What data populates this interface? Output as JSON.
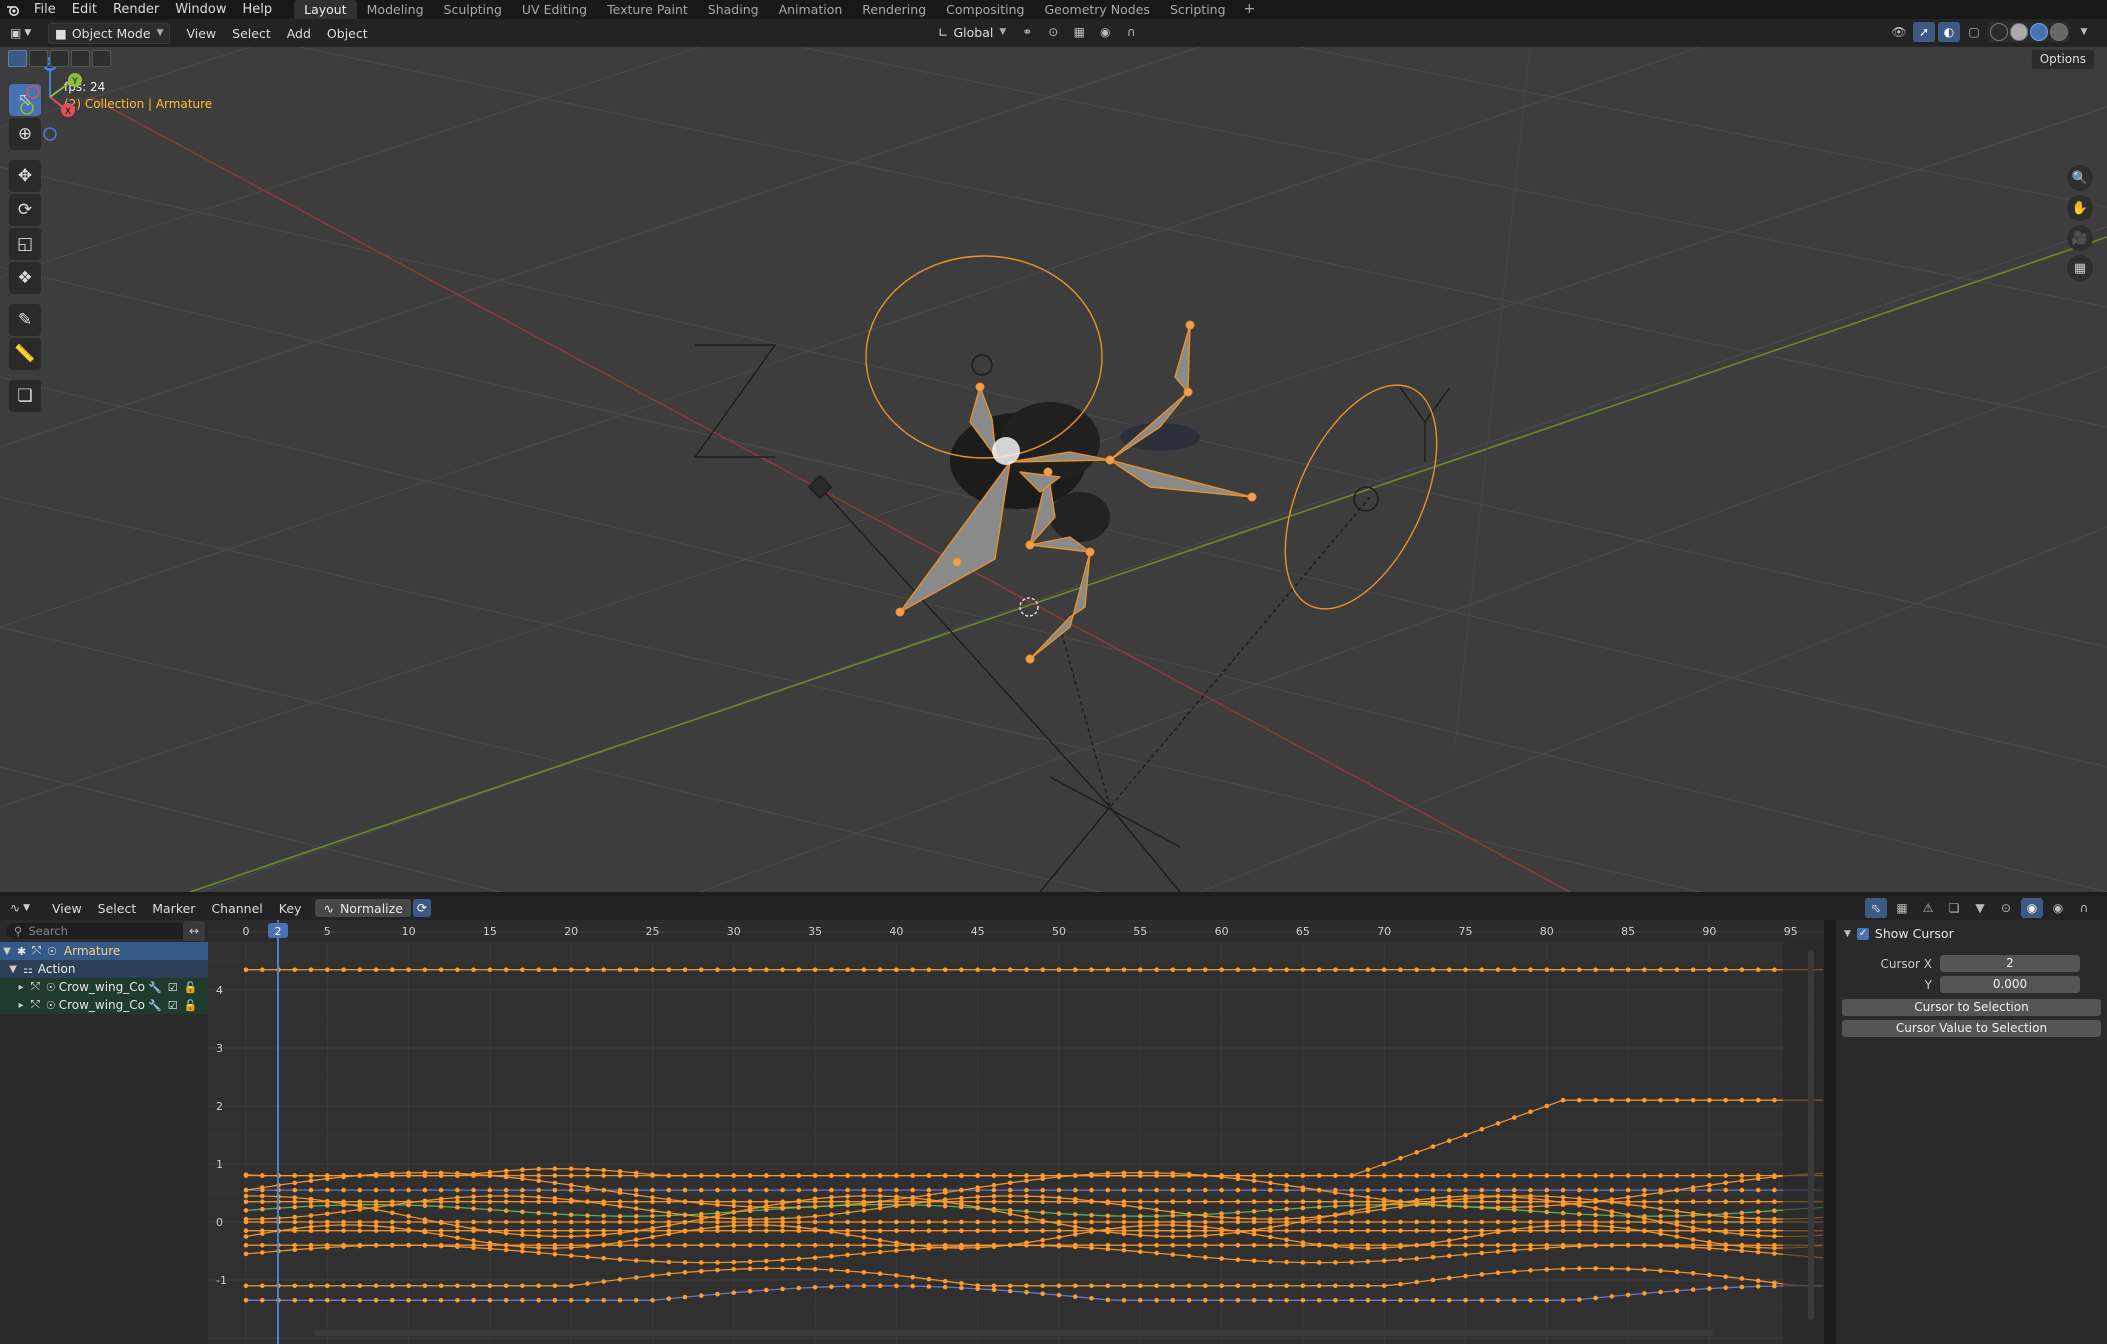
{
  "topbar": {
    "menus": [
      "File",
      "Edit",
      "Render",
      "Window",
      "Help"
    ],
    "workspaces": [
      "Layout",
      "Modeling",
      "Sculpting",
      "UV Editing",
      "Texture Paint",
      "Shading",
      "Animation",
      "Rendering",
      "Compositing",
      "Geometry Nodes",
      "Scripting"
    ],
    "active_workspace": "Layout",
    "add_tab": "+"
  },
  "viewport_header": {
    "mode": "Object Mode",
    "menus": [
      "View",
      "Select",
      "Add",
      "Object"
    ],
    "transform_orientation": "Global",
    "options": "Options"
  },
  "viewport": {
    "fps": "fps: 24",
    "collection": "(2) Collection | Armature",
    "axis_labels": {
      "x": "X",
      "y": "Y",
      "z": "Z"
    },
    "background_color": "#3d3d3d"
  },
  "graph_header": {
    "menus": [
      "View",
      "Select",
      "Marker",
      "Channel",
      "Key"
    ],
    "normalize": "Normalize"
  },
  "channels": {
    "search_placeholder": "Search",
    "rows": [
      {
        "label": "Armature",
        "kind": "object"
      },
      {
        "label": "Action",
        "kind": "action"
      },
      {
        "label": "Crow_wing_Co",
        "kind": "fcurve"
      },
      {
        "label": "Crow_wing_Co",
        "kind": "fcurve"
      }
    ]
  },
  "graph": {
    "frame_ticks": [
      "0",
      "5",
      "10",
      "15",
      "20",
      "25",
      "30",
      "35",
      "40",
      "45",
      "50",
      "55",
      "60",
      "65",
      "70",
      "75",
      "80",
      "85",
      "90",
      "95"
    ],
    "current_frame": "2",
    "value_ticks": [
      "4",
      "3",
      "2",
      "1",
      "0",
      "-1"
    ],
    "accent": "#ff9a2a"
  },
  "sidebar": {
    "show_cursor": "Show Cursor",
    "cursor_x_label": "Cursor X",
    "cursor_x": "2",
    "y_label": "Y",
    "cursor_y": "0.000",
    "cursor_to_selection": "Cursor to Selection",
    "cursor_value_to_selection": "Cursor Value to Selection"
  }
}
